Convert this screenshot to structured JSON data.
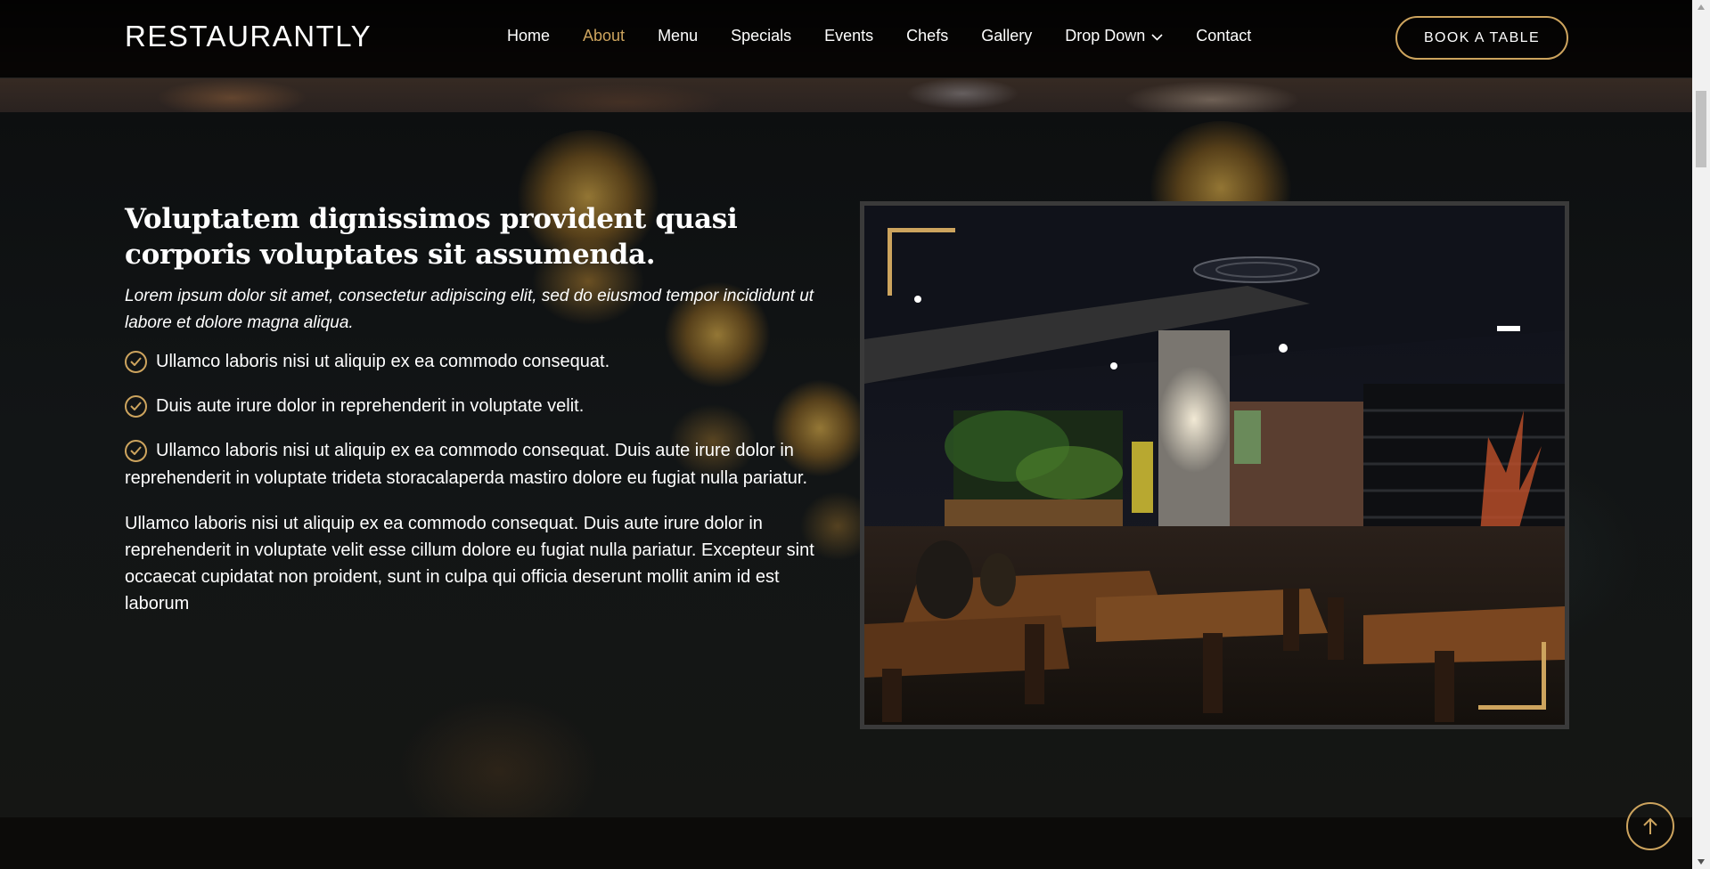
{
  "header": {
    "logo": "RESTAURANTLY",
    "nav": [
      {
        "label": "Home",
        "active": false
      },
      {
        "label": "About",
        "active": true
      },
      {
        "label": "Menu",
        "active": false
      },
      {
        "label": "Specials",
        "active": false
      },
      {
        "label": "Events",
        "active": false
      },
      {
        "label": "Chefs",
        "active": false
      },
      {
        "label": "Gallery",
        "active": false
      },
      {
        "label": "Drop Down",
        "active": false,
        "icon": "chevron-down-icon"
      },
      {
        "label": "Contact",
        "active": false
      }
    ],
    "cta": "BOOK A TABLE"
  },
  "about": {
    "title": "Voluptatem dignissimos provident quasi corporis voluptates sit assumenda.",
    "lead": "Lorem ipsum dolor sit amet, consectetur adipiscing elit, sed do eiusmod tempor incididunt ut labore et dolore magna aliqua.",
    "checklist": [
      "Ullamco laboris nisi ut aliquip ex ea commodo consequat.",
      "Duis aute irure dolor in reprehenderit in voluptate velit.",
      "Ullamco laboris nisi ut aliquip ex ea commodo consequat. Duis aute irure dolor in reprehenderit in voluptate trideta storacalaperda mastiro dolore eu fugiat nulla pariatur."
    ],
    "paragraph": "Ullamco laboris nisi ut aliquip ex ea commodo consequat. Duis aute irure dolor in reprehenderit in voluptate velit esse cillum dolore eu fugiat nulla pariatur. Excepteur sint occaecat cupidatat non proident, sunt in culpa qui officia deserunt mollit anim id est laborum"
  },
  "icons": {
    "check": "check-circle-icon",
    "back_to_top": "arrow-up-icon"
  },
  "colors": {
    "accent": "#cda45e",
    "background": "#0c0b09",
    "text": "#ffffff"
  }
}
